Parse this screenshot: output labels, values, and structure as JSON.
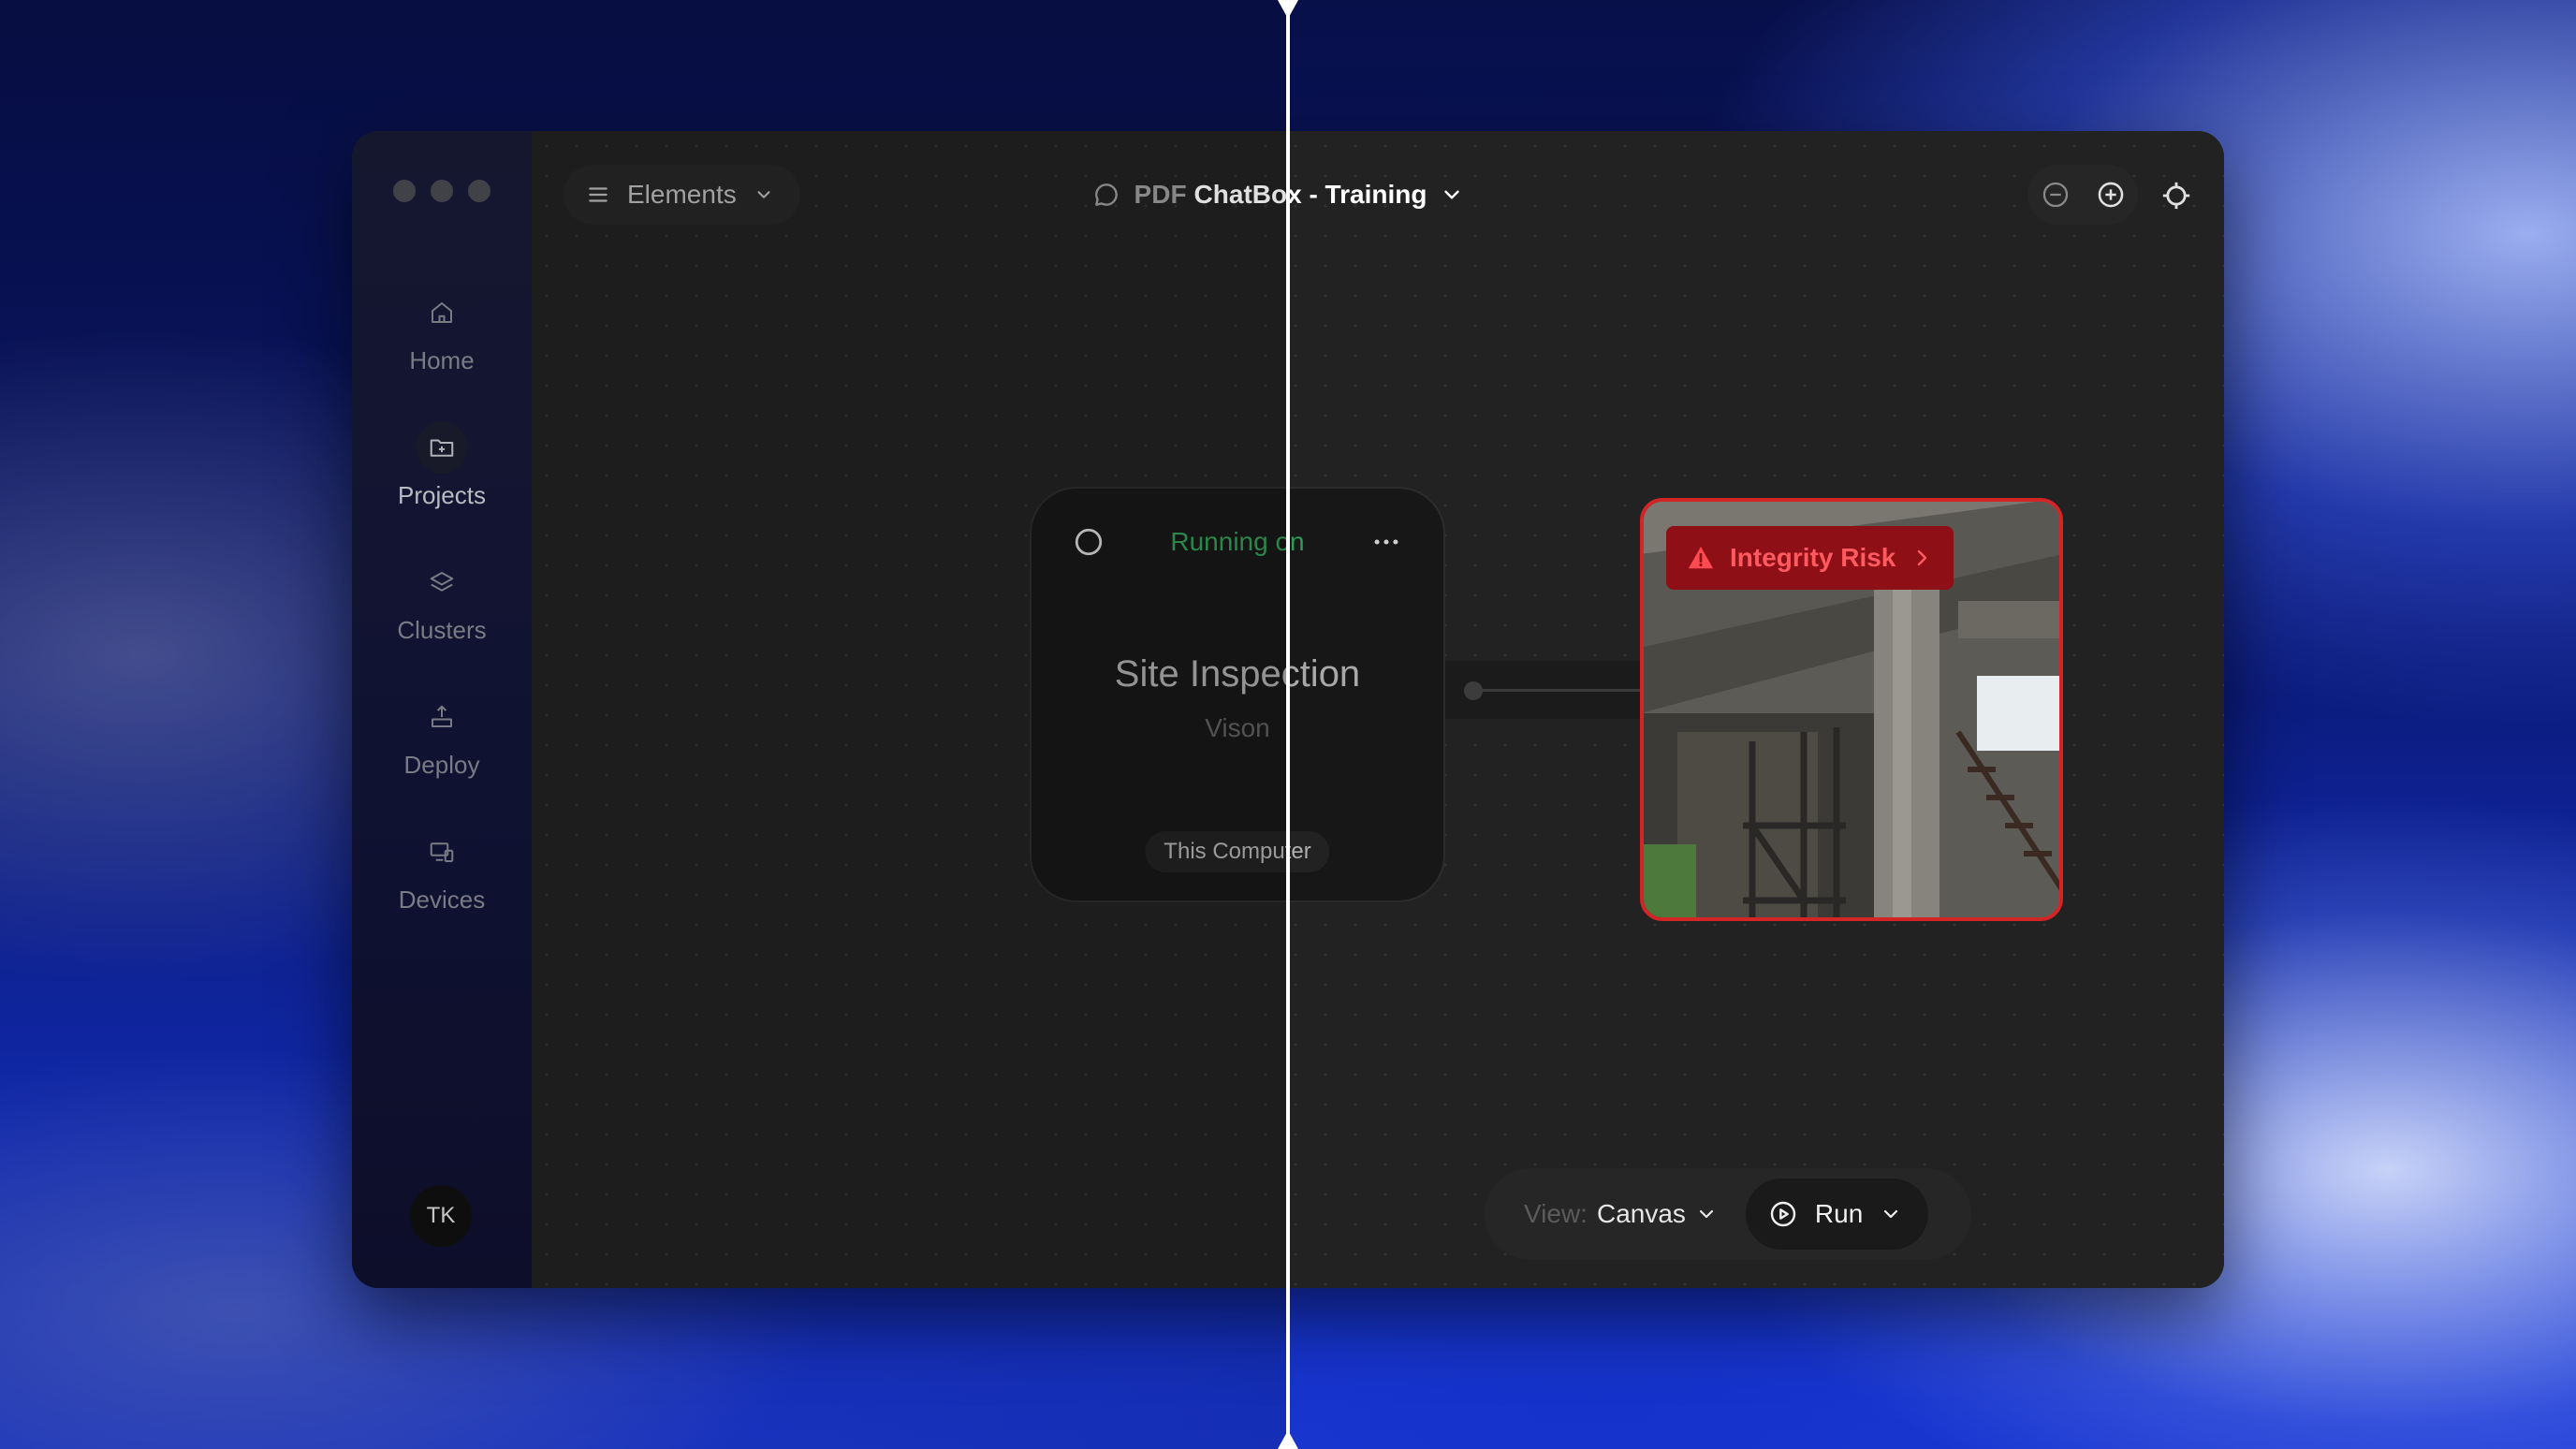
{
  "window": {
    "title_prefix": "PDF",
    "title_main": "ChatBox - Training"
  },
  "sidebar": {
    "items": [
      {
        "label": "Home",
        "icon": "home-icon"
      },
      {
        "label": "Projects",
        "icon": "folder-plus-icon"
      },
      {
        "label": "Clusters",
        "icon": "layers-icon"
      },
      {
        "label": "Deploy",
        "icon": "upload-icon"
      },
      {
        "label": "Devices",
        "icon": "devices-icon"
      }
    ],
    "active": "Projects",
    "avatar_initials": "TK"
  },
  "toolbar": {
    "elements_label": "Elements"
  },
  "node": {
    "status": "Running on",
    "title": "Site Inspection",
    "subtitle": "Vison",
    "device": "This Computer"
  },
  "image_node": {
    "badge": "Integrity Risk",
    "badge_color": "#8e0f16",
    "border_color": "#d32525"
  },
  "bottom": {
    "view_label": "View:",
    "view_value": "Canvas",
    "run_label": "Run"
  },
  "colors": {
    "running": "#2f9a56"
  }
}
